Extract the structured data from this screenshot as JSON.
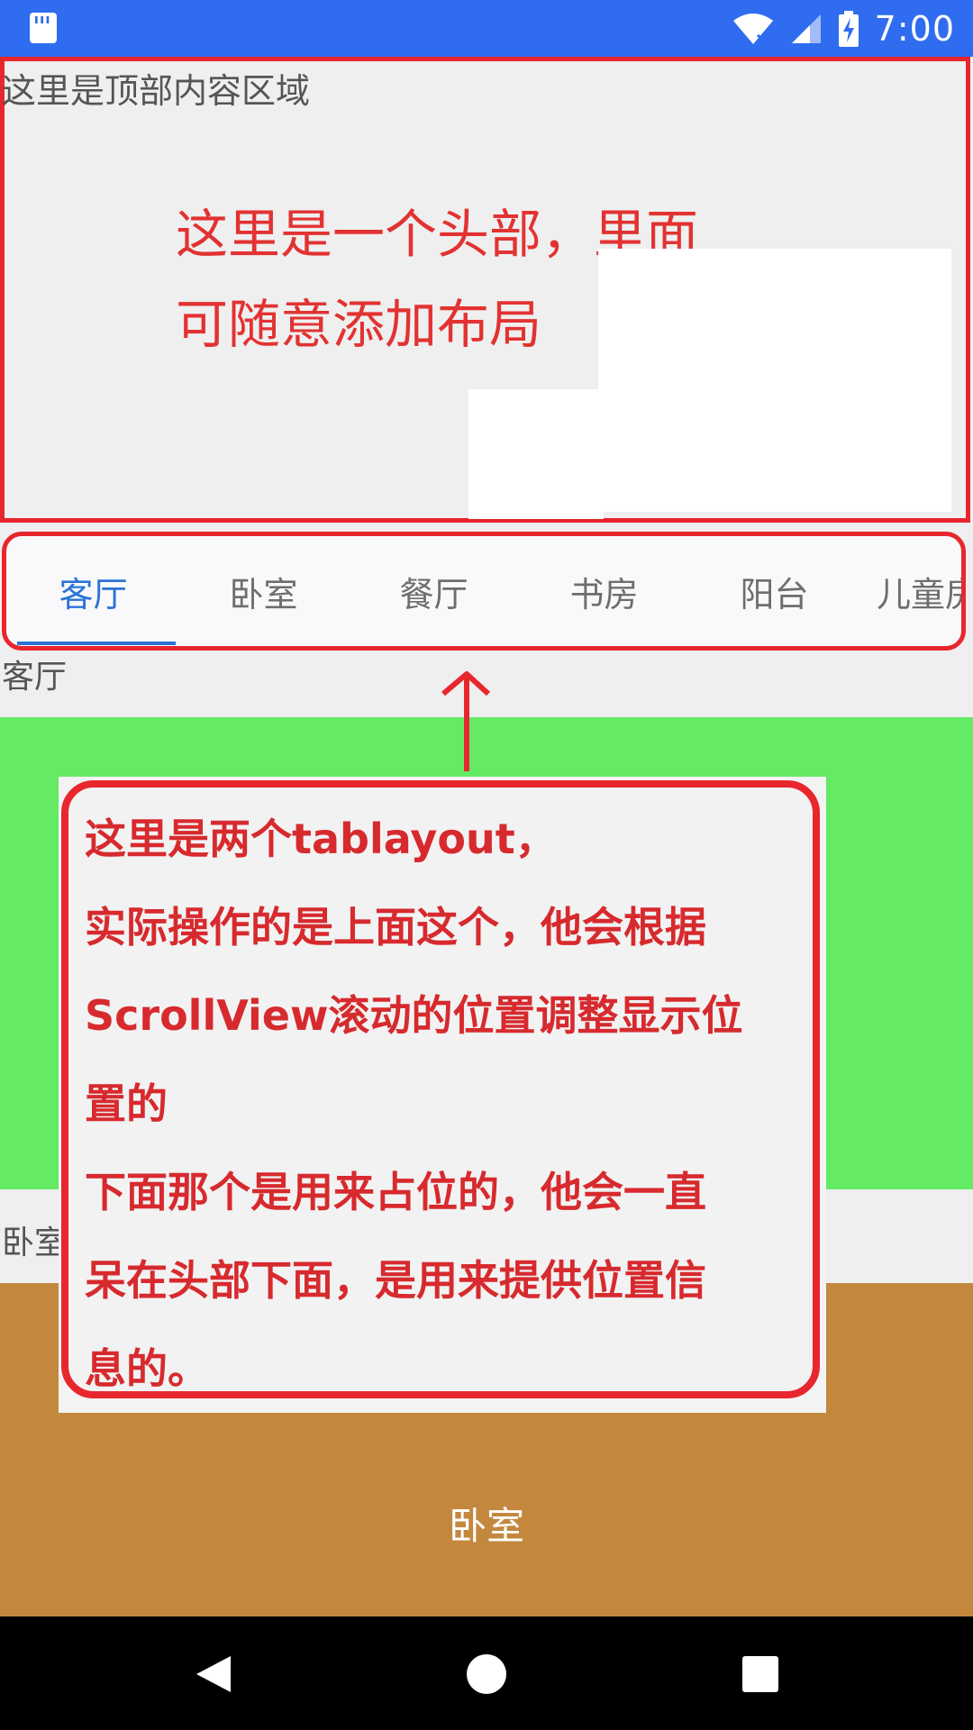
{
  "status_bar": {
    "time": "7:00",
    "icons": [
      "sd-card-icon",
      "wifi-icon",
      "signal-icon",
      "battery-charging-icon"
    ],
    "bg_color": "#2f6cf0"
  },
  "header": {
    "top_label": "这里是顶部内容区域",
    "annotation_line1": "这里是一个头部，里面",
    "annotation_line2": "可随意添加布局",
    "border_color": "#e8262e"
  },
  "tabs": {
    "items": [
      "客厅",
      "卧室",
      "餐厅",
      "书房",
      "阳台",
      "儿童房"
    ],
    "active_index": 0,
    "active_color": "#2b73d6"
  },
  "sections": {
    "living_room_label": "客厅",
    "bedroom_label": "卧室",
    "bedroom_center_label": "卧室",
    "green_color": "#64ea64",
    "brown_color": "#c3883e"
  },
  "annotation_note": {
    "lines": [
      "这里是两个tablayout，",
      "实际操作的是上面这个，他会根据",
      "ScrollView滚动的位置调整显示位",
      "置的",
      "下面那个是用来占位的，他会一直",
      "呆在头部下面，是用来提供位置信",
      "息的。"
    ]
  },
  "nav_bar": {
    "icons": [
      "back-icon",
      "home-icon",
      "recent-apps-icon"
    ]
  }
}
